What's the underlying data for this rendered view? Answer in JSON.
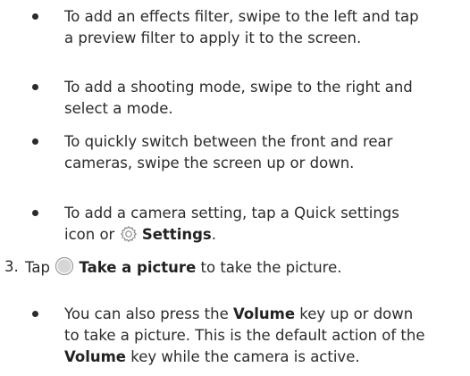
{
  "bullets_top": [
    {
      "line1": "To add an effects filter, swipe to the left and tap",
      "line2": "a preview filter to apply it to the screen."
    },
    {
      "line1": "To add a shooting mode, swipe to the right and",
      "line2": "select a mode."
    },
    {
      "line1": "To quickly switch between the front and rear",
      "line2": "cameras, swipe the screen up or down."
    },
    {
      "line1": "To add a camera setting, tap a Quick settings",
      "line2_prefix": "icon or",
      "line2_bold": "Settings",
      "line2_suffix": "."
    }
  ],
  "step3": {
    "number": "3.",
    "prefix": "Tap",
    "bold": "Take a picture",
    "suffix": "to take the picture."
  },
  "sub_bullet": {
    "line1_prefix": "You can also press the",
    "line1_bold": "Volume",
    "line1_suffix": "key up or down",
    "line2": "to take a picture. This is the default action of the",
    "line3_bold": "Volume",
    "line3_suffix": "key while the camera is active."
  },
  "icons": {
    "settings": "gear-icon",
    "shutter": "shutter-button-icon"
  }
}
